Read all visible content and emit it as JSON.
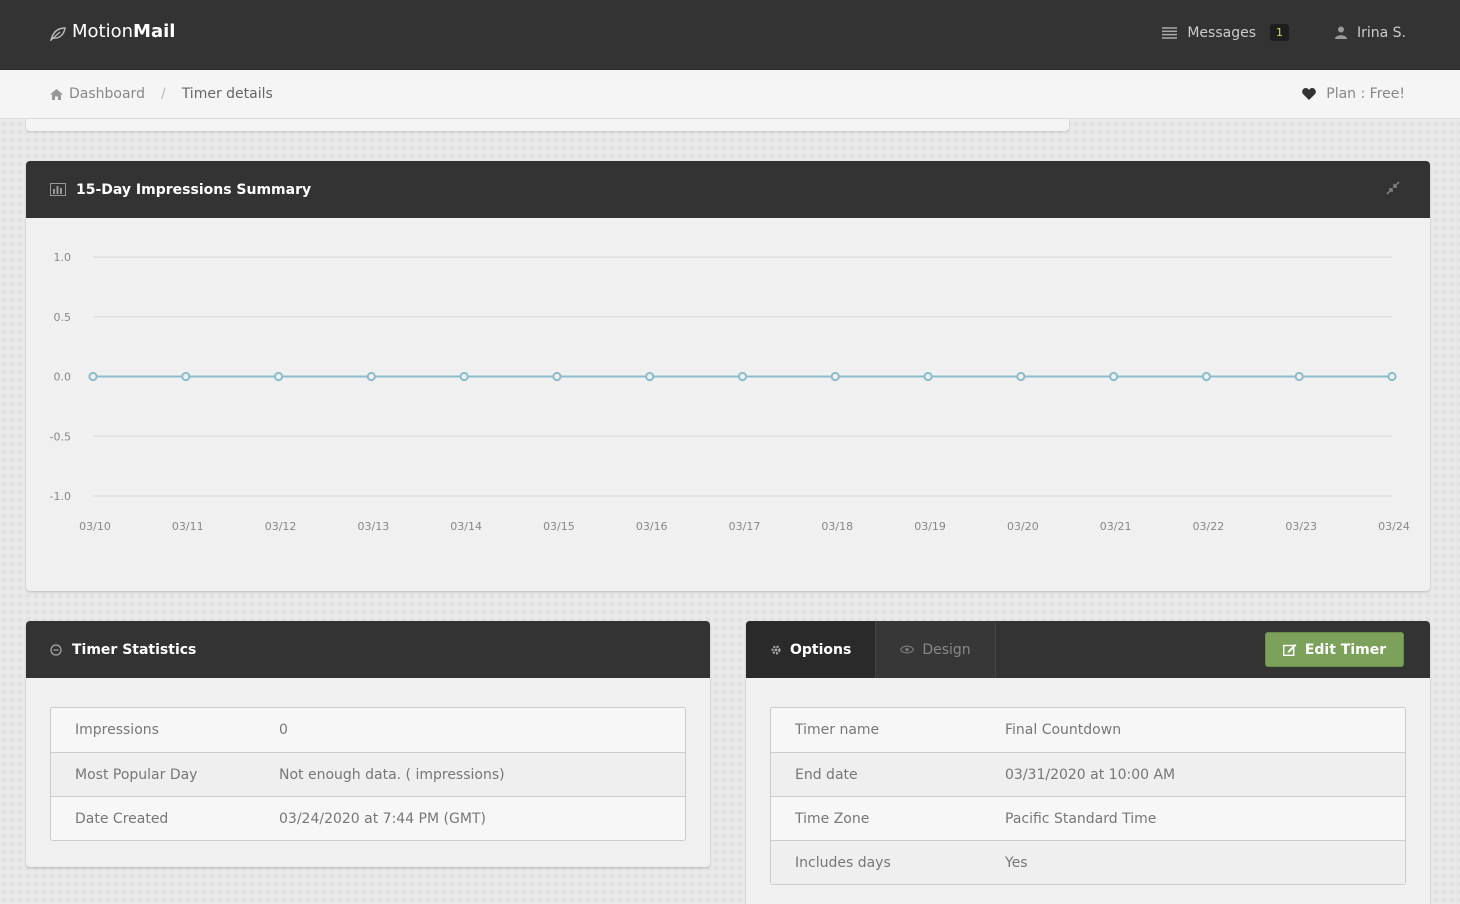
{
  "app": {
    "brand_prefix": "Motion",
    "brand_suffix": "Mail"
  },
  "topnav": {
    "messages_label": "Messages",
    "messages_count": "1",
    "user_name": "Irina S."
  },
  "breadcrumb": {
    "home": "Dashboard",
    "separator": "/",
    "current": "Timer details"
  },
  "plan": {
    "label": "Plan : Free!"
  },
  "chart_panel": {
    "title": "15-Day Impressions Summary"
  },
  "chart_data": {
    "type": "line",
    "categories": [
      "03/10",
      "03/11",
      "03/12",
      "03/13",
      "03/14",
      "03/15",
      "03/16",
      "03/17",
      "03/18",
      "03/19",
      "03/20",
      "03/21",
      "03/22",
      "03/23",
      "03/24"
    ],
    "series": [
      {
        "values": [
          0,
          0,
          0,
          0,
          0,
          0,
          0,
          0,
          0,
          0,
          0,
          0,
          0,
          0,
          0
        ]
      }
    ],
    "yticks": [
      1.0,
      0.5,
      0.0,
      -0.5,
      -1.0
    ],
    "ylim": [
      -1.0,
      1.0
    ],
    "grid": true,
    "line_color": "#8bbccc"
  },
  "stats_panel": {
    "title": "Timer Statistics",
    "rows": [
      {
        "key": "Impressions",
        "value": "0"
      },
      {
        "key": "Most Popular Day",
        "value": "Not enough data. ( impressions)"
      },
      {
        "key": "Date Created",
        "value": "03/24/2020 at 7:44 PM (GMT)"
      }
    ]
  },
  "options_panel": {
    "tab_options": "Options",
    "tab_design": "Design",
    "edit_button": "Edit Timer",
    "rows": [
      {
        "key": "Timer name",
        "value": "Final Countdown"
      },
      {
        "key": "End date",
        "value": "03/31/2020 at 10:00 AM"
      },
      {
        "key": "Time Zone",
        "value": "Pacific Standard Time"
      },
      {
        "key": "Includes days",
        "value": "Yes"
      }
    ]
  },
  "colors": {
    "topbar": "#333333",
    "accent_green": "#7ca15a",
    "badge_text": "#c9e26b"
  }
}
